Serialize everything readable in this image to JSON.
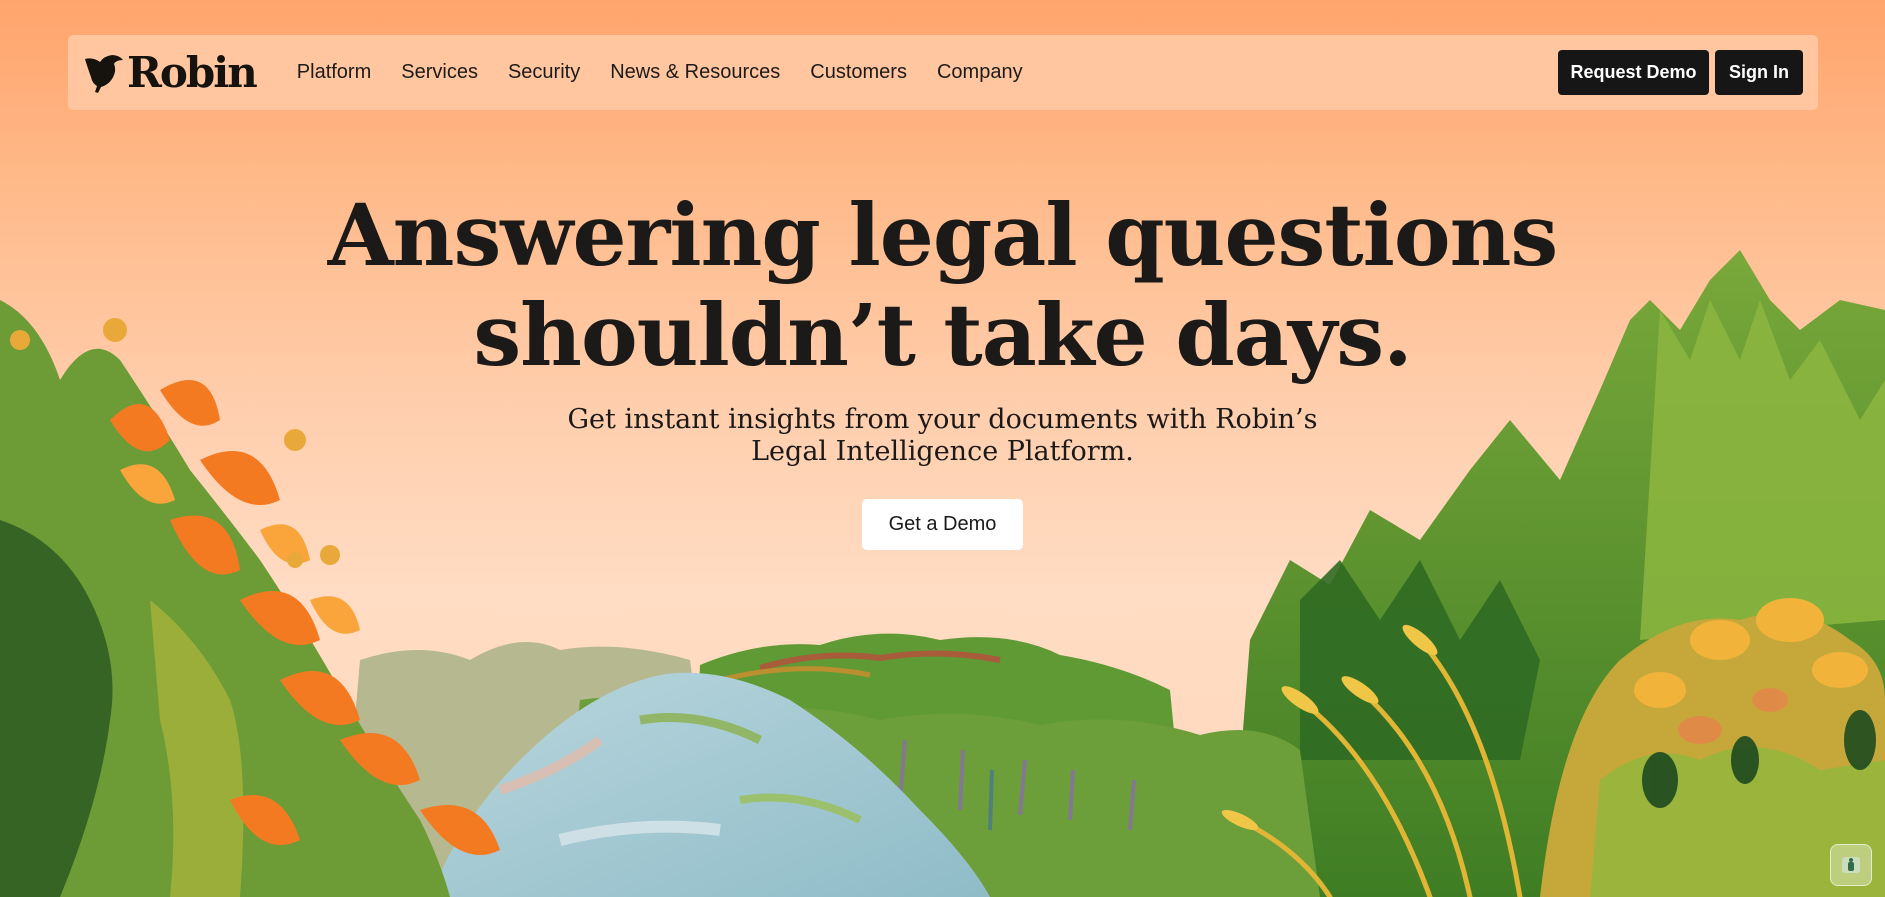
{
  "brand": {
    "name": "Robin",
    "logo_icon": "robin-bird-icon"
  },
  "nav": {
    "links": [
      "Platform",
      "Services",
      "Security",
      "News & Resources",
      "Customers",
      "Company"
    ],
    "request_demo_label": "Request Demo",
    "sign_in_label": "Sign In"
  },
  "hero": {
    "title_line1": "Answering legal questions",
    "title_line2": "shouldn’t take days.",
    "subtitle_line1": "Get instant insights from your documents with Robin’s",
    "subtitle_line2": "Legal Intelligence Platform.",
    "cta_label": "Get a Demo"
  },
  "chat_widget": {
    "icon": "chat-launcher-icon"
  },
  "colors": {
    "background_top": "#ffa46c",
    "background_bottom": "#ffdcc3",
    "nav_bar": "#ffc6a0",
    "button_dark": "#161616",
    "cta_background": "#ffffff",
    "text": "#1c1a19"
  }
}
